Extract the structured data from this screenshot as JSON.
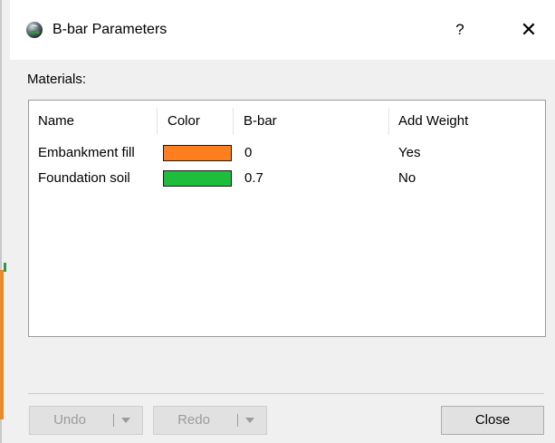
{
  "dialog": {
    "title": "B-bar Parameters",
    "help_label": "?",
    "close_glyph": "✕"
  },
  "materials": {
    "label": "Materials:",
    "columns": [
      "Name",
      "Color",
      "B-bar",
      "Add Weight"
    ],
    "rows": [
      {
        "name": "Embankment fill",
        "color": "#ff7f1e",
        "bbar": "0",
        "add_weight": "Yes"
      },
      {
        "name": "Foundation soil",
        "color": "#1ebe3c",
        "bbar": "0.7",
        "add_weight": "No"
      }
    ]
  },
  "buttons": {
    "undo": "Undo",
    "redo": "Redo",
    "close": "Close"
  },
  "icons": {
    "app": "globe-icon",
    "dropdown": "chevron-down-icon"
  }
}
